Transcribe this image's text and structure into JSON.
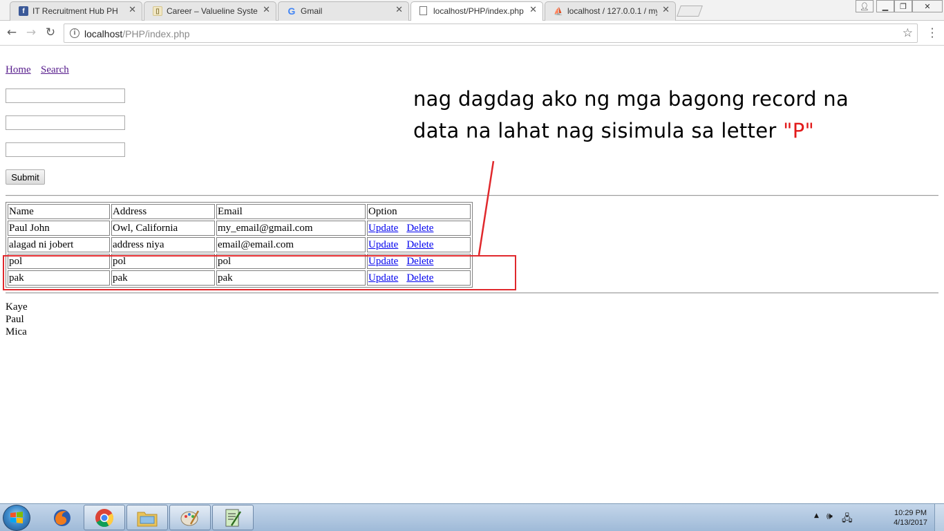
{
  "browser": {
    "tabs": [
      {
        "title": "IT Recruitment Hub PH",
        "favicon": "facebook-icon",
        "active": false
      },
      {
        "title": "Career – Valueline System",
        "favicon": "page-icon",
        "active": false
      },
      {
        "title": "Gmail",
        "favicon": "google-icon",
        "active": false
      },
      {
        "title": "localhost/PHP/index.php",
        "favicon": "document-icon",
        "active": true
      },
      {
        "title": "localhost / 127.0.0.1 / my",
        "favicon": "phpmyadmin-icon",
        "active": false
      }
    ],
    "url_host": "localhost",
    "url_path": "/PHP/index.php"
  },
  "page": {
    "nav": {
      "home": "Home",
      "search": "Search"
    },
    "form": {
      "field1": "",
      "field2": "",
      "field3": "",
      "submit_label": "Submit"
    },
    "table": {
      "headers": [
        "Name",
        "Address",
        "Email",
        "Option"
      ],
      "rows": [
        {
          "name": "Paul John",
          "address": "Owl, California",
          "email": "my_email@gmail.com",
          "update": "Update",
          "delete": "Delete"
        },
        {
          "name": "alagad ni jobert",
          "address": "address niya",
          "email": "email@email.com",
          "update": "Update",
          "delete": "Delete"
        },
        {
          "name": "pol",
          "address": "pol",
          "email": "pol",
          "update": "Update",
          "delete": "Delete"
        },
        {
          "name": "pak",
          "address": "pak",
          "email": "pak",
          "update": "Update",
          "delete": "Delete"
        }
      ]
    },
    "names": [
      "Kaye",
      "Paul",
      "Mica"
    ]
  },
  "annotation": {
    "line1": "nag dagdag ako ng mga bagong record na",
    "line2": "data na lahat nag sisimula sa letter ",
    "highlight": "\"P\"",
    "accent_color": "#e21b1b"
  },
  "taskbar": {
    "time": "10:29 PM",
    "date": "4/13/2017",
    "apps": [
      "firefox-icon",
      "chrome-icon",
      "explorer-icon",
      "paint-icon",
      "notepadpp-icon"
    ]
  }
}
